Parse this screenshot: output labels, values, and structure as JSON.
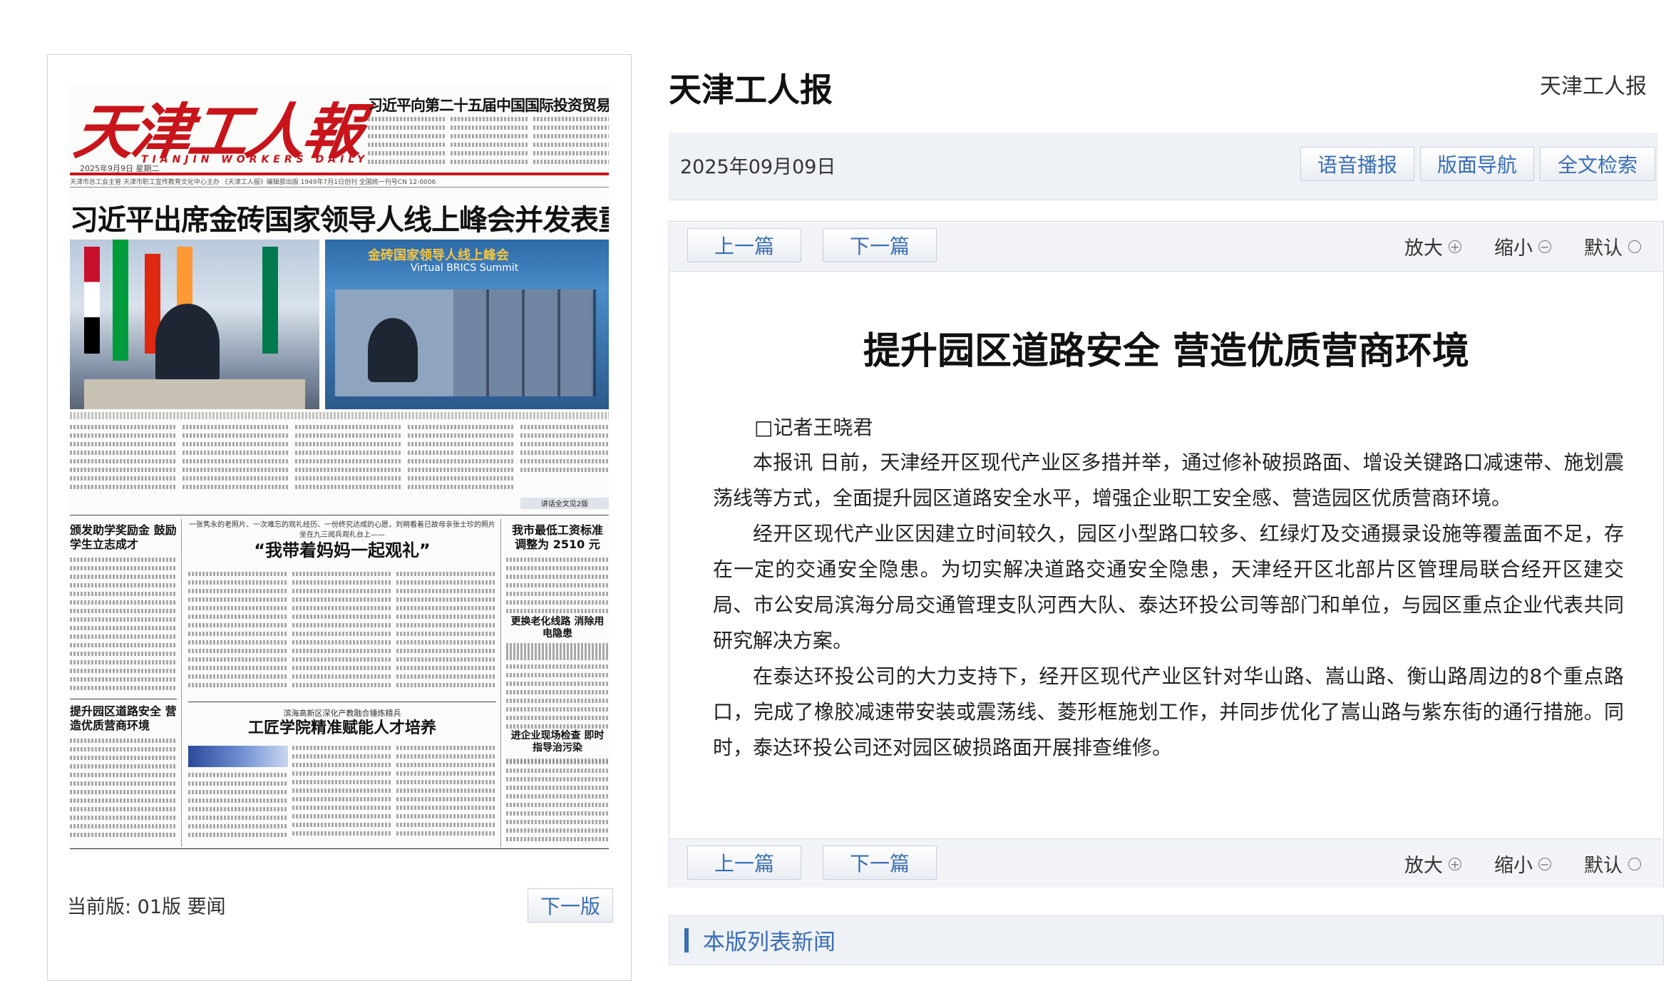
{
  "site": {
    "title": "天津工人报",
    "title_right": "天津工人报"
  },
  "issue": {
    "date": "2025年09月09日"
  },
  "toolbar": {
    "audio": "语音播报",
    "page_nav": "版面导航",
    "search": "全文检索"
  },
  "article_nav": {
    "prev": "上一篇",
    "next": "下一篇",
    "zoom_in": "放大",
    "zoom_out": "缩小",
    "zoom_default": "默认"
  },
  "article": {
    "title": "提升园区道路安全 营造优质营商环境",
    "author": "□记者王晓君",
    "paragraphs": [
      "本报讯 日前，天津经开区现代产业区多措并举，通过修补破损路面、增设关键路口减速带、施划震荡线等方式，全面提升园区道路安全水平，增强企业职工安全感、营造园区优质营商环境。",
      "经开区现代产业区因建立时间较久，园区小型路口较多、红绿灯及交通摄录设施等覆盖面不足，存在一定的交通安全隐患。为切实解决道路交通安全隐患，天津经开区北部片区管理局联合经开区建交局、市公安局滨海分局交通管理支队河西大队、泰达环投公司等部门和单位，与园区重点企业代表共同研究解决方案。",
      "在泰达环投公司的大力支持下，经开区现代产业区针对华山路、嵩山路、衡山路周边的8个重点路口，完成了橡胶减速带安装或震荡线、菱形框施划工作，并同步优化了嵩山路与紫东街的通行措施。同时，泰达环投公司还对园区破损路面开展排查维修。"
    ]
  },
  "list_section": {
    "title": "本版列表新闻"
  },
  "edition": {
    "current": "当前版: 01版 要闻",
    "next": "下一版"
  },
  "newspaper": {
    "masthead": "天津工人報",
    "masthead_en": "TIANJIN WORKERS DAILY",
    "date_line": "2025年9月9日 星期二",
    "top_headline": "习近平向第二十五届中国国际投资贸易洽谈会致贺信",
    "info_line": "天津市总工会主管 天津市职工宣传教育文化中心主办 《天津工人报》编辑部出版 1949年7月1日创刊 全国统一刊号CN 12-0006",
    "main_headline": "习近平出席金砖国家领导人线上峰会并发表重要讲话",
    "summit_banner": "金砖国家领导人线上峰会",
    "summit_banner_en": "Virtual BRICS Summit",
    "h_left1": "颁发助学奖励金 鼓励学生立志成才",
    "h_mid_kicker": "一张隽永的老照片、一次难忘的观礼经历、一份终究达成的心愿，刘朔看着已故母亲张士珍的照片坐在九三阅兵观礼台上——",
    "h_mid": "“我带着妈妈一起观礼”",
    "h_right1": "我市最低工资标准 调整为 2510 元",
    "h_right2": "更换老化线路 消除用电隐患",
    "h_left2": "提升园区道路安全 营造优质营商环境",
    "h_mid2_kicker": "滨海高新区深化产教融合锤炼精兵",
    "h_mid2": "工匠学院精准赋能人才培养",
    "h_right3": "进企业现场检查 即时指导治污染",
    "continued": "讲话全文见2版"
  }
}
